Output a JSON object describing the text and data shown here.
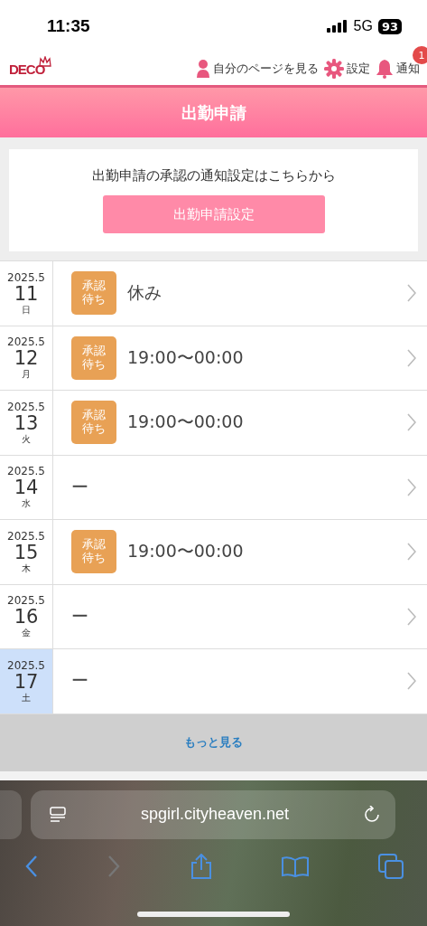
{
  "status_bar": {
    "time": "11:35",
    "network": "5G",
    "battery": "93"
  },
  "header": {
    "logo": "DECO",
    "links": [
      {
        "kind": "person",
        "label": "自分のページを見る"
      },
      {
        "kind": "gear",
        "label": "設定"
      },
      {
        "kind": "bell",
        "label": "通知",
        "badge": "1"
      }
    ]
  },
  "title": "出勤申請",
  "notice": {
    "text": "出勤申請の承認の通知設定はこちらから",
    "button": "出勤申請設定"
  },
  "days": [
    {
      "month": "2025.5",
      "day": "11",
      "weekday": "日",
      "today": false,
      "status": "承認待ち",
      "value": "休み"
    },
    {
      "month": "2025.5",
      "day": "12",
      "weekday": "月",
      "today": false,
      "status": "承認待ち",
      "value": "19:00〜00:00"
    },
    {
      "month": "2025.5",
      "day": "13",
      "weekday": "火",
      "today": false,
      "status": "承認待ち",
      "value": "19:00〜00:00"
    },
    {
      "month": "2025.5",
      "day": "14",
      "weekday": "水",
      "today": false,
      "value": "ー"
    },
    {
      "month": "2025.5",
      "day": "15",
      "weekday": "木",
      "today": false,
      "status": "承認待ち",
      "value": "19:00〜00:00"
    },
    {
      "month": "2025.5",
      "day": "16",
      "weekday": "金",
      "today": false,
      "value": "ー"
    },
    {
      "month": "2025.5",
      "day": "17",
      "weekday": "土",
      "today": true,
      "value": "ー"
    }
  ],
  "more_button": "もっと見る",
  "browser": {
    "url": "spgirl.cityheaven.net",
    "forward_enabled": false
  }
}
